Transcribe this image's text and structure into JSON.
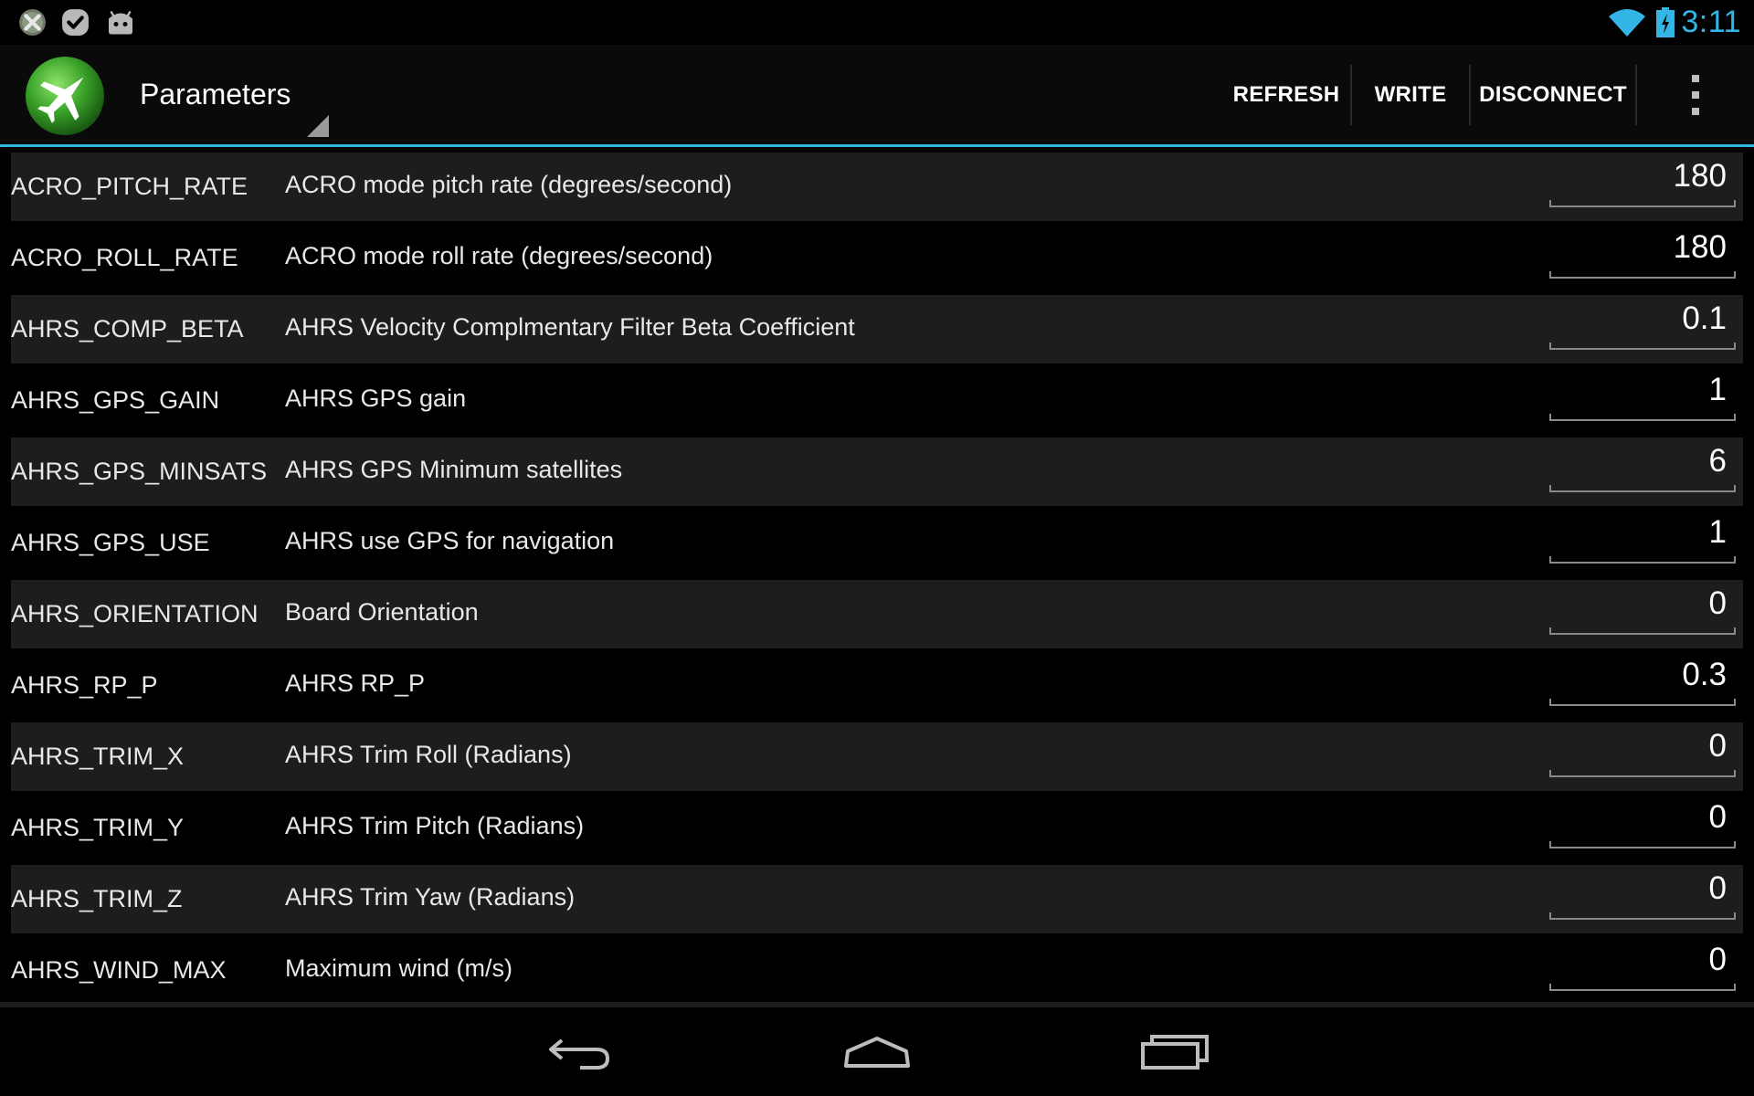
{
  "status_bar": {
    "time": "3:11",
    "icons": [
      "app-notification-icon",
      "checkmark-notification-icon",
      "android-notification-icon",
      "wifi-icon",
      "battery-charging-icon"
    ]
  },
  "action_bar": {
    "title": "Parameters",
    "buttons": {
      "refresh": "REFRESH",
      "write": "WRITE",
      "disconnect": "DISCONNECT"
    }
  },
  "colors": {
    "accent": "#33b5e5",
    "row_alt": "#1b1d1f",
    "background": "#000000",
    "logo_green": "#3aa32a"
  },
  "parameters": [
    {
      "name": "ACRO_PITCH_RATE",
      "description": "ACRO mode pitch rate (degrees/second)",
      "value": "180"
    },
    {
      "name": "ACRO_ROLL_RATE",
      "description": "ACRO mode roll rate (degrees/second)",
      "value": "180"
    },
    {
      "name": "AHRS_COMP_BETA",
      "description": "AHRS Velocity Complmentary Filter Beta Coefficient",
      "value": "0.1"
    },
    {
      "name": "AHRS_GPS_GAIN",
      "description": "AHRS GPS gain",
      "value": "1"
    },
    {
      "name": "AHRS_GPS_MINSATS",
      "description": "AHRS GPS Minimum satellites",
      "value": "6"
    },
    {
      "name": "AHRS_GPS_USE",
      "description": "AHRS use GPS for navigation",
      "value": "1"
    },
    {
      "name": "AHRS_ORIENTATION",
      "description": "Board Orientation",
      "value": "0"
    },
    {
      "name": "AHRS_RP_P",
      "description": "AHRS RP_P",
      "value": "0.3"
    },
    {
      "name": "AHRS_TRIM_X",
      "description": "AHRS Trim Roll (Radians)",
      "value": "0"
    },
    {
      "name": "AHRS_TRIM_Y",
      "description": "AHRS Trim Pitch (Radians)",
      "value": "0"
    },
    {
      "name": "AHRS_TRIM_Z",
      "description": "AHRS Trim Yaw (Radians)",
      "value": "0"
    },
    {
      "name": "AHRS_WIND_MAX",
      "description": "Maximum wind (m/s)",
      "value": "0"
    }
  ],
  "nav_bar": {
    "icons": [
      "back-icon",
      "home-icon",
      "recent-apps-icon"
    ]
  }
}
